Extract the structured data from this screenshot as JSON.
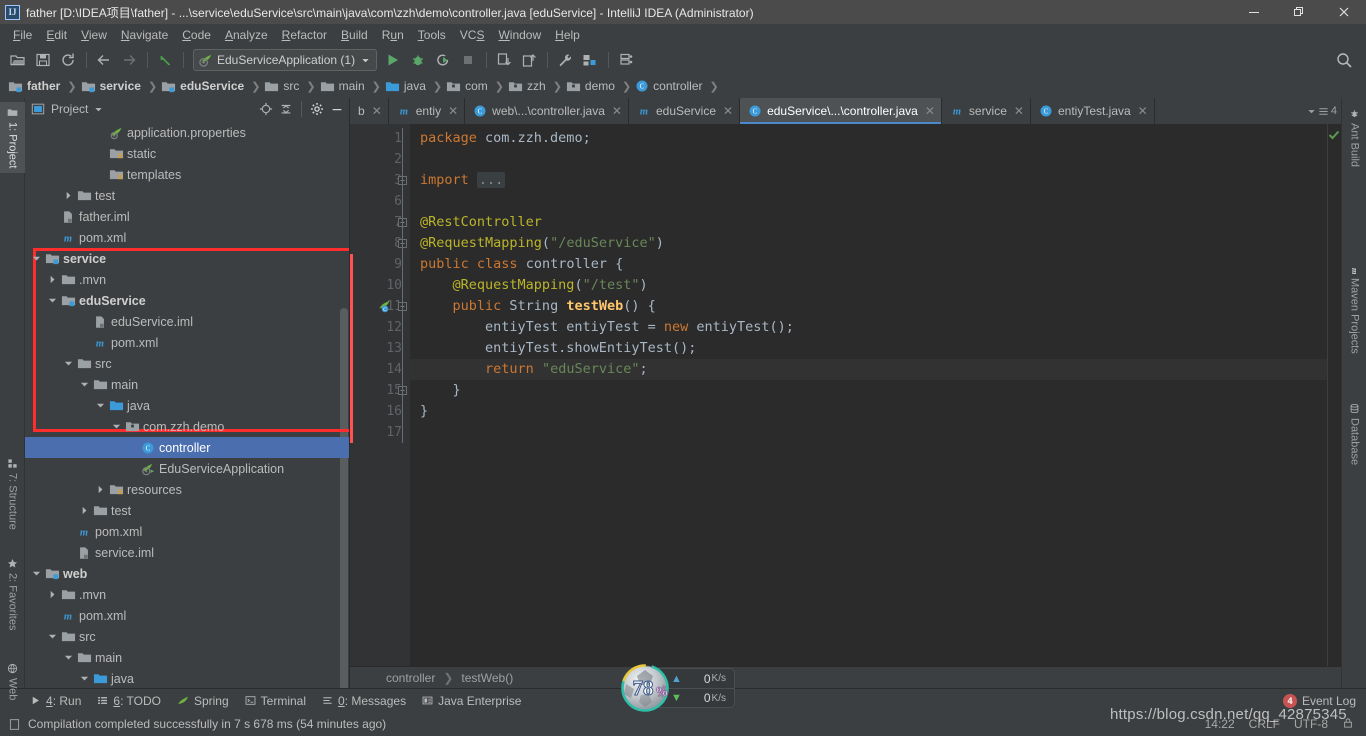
{
  "window": {
    "title": "father [D:\\IDEA项目\\father] - ...\\service\\eduService\\src\\main\\java\\com\\zzh\\demo\\controller.java [eduService] - IntelliJ IDEA (Administrator)",
    "logo": "IJ",
    "minimize": "minimize-icon",
    "maximize": "restore-icon",
    "close": "close-icon"
  },
  "menubar": {
    "items": [
      {
        "label": "File",
        "mnemonic": "F"
      },
      {
        "label": "Edit",
        "mnemonic": "E"
      },
      {
        "label": "View",
        "mnemonic": "V"
      },
      {
        "label": "Navigate",
        "mnemonic": "N"
      },
      {
        "label": "Code",
        "mnemonic": "C"
      },
      {
        "label": "Analyze",
        "mnemonic": "A"
      },
      {
        "label": "Refactor",
        "mnemonic": "R"
      },
      {
        "label": "Build",
        "mnemonic": "B"
      },
      {
        "label": "Run",
        "mnemonic": "u"
      },
      {
        "label": "Tools",
        "mnemonic": "T"
      },
      {
        "label": "VCS",
        "mnemonic": "S"
      },
      {
        "label": "Window",
        "mnemonic": "W"
      },
      {
        "label": "Help",
        "mnemonic": "H"
      }
    ]
  },
  "toolbar": {
    "run_config": "EduServiceApplication (1)",
    "icons": [
      "open-folder-icon",
      "save-all-icon",
      "sync-refresh-icon",
      "back-arrow-icon",
      "forward-arrow-icon",
      "undo-arrow-icon"
    ],
    "run_icons": [
      "run-icon",
      "debug-icon",
      "run-with-coverage-icon",
      "stop-icon"
    ],
    "extra_icons": [
      "update-project-icon",
      "commit-icon",
      "settings-wrench-icon",
      "project-structure-icon",
      "sdk-manager-icon"
    ],
    "search_icon": "search-icon"
  },
  "navbar": {
    "crumbs": [
      {
        "label": "father",
        "icon": "module-icon",
        "bold": true
      },
      {
        "label": "service",
        "icon": "module-icon",
        "bold": true
      },
      {
        "label": "eduService",
        "icon": "module-icon",
        "bold": true
      },
      {
        "label": "src",
        "icon": "folder-icon",
        "bold": false
      },
      {
        "label": "main",
        "icon": "folder-icon",
        "bold": false
      },
      {
        "label": "java",
        "icon": "source-folder-icon",
        "bold": false
      },
      {
        "label": "com",
        "icon": "package-icon",
        "bold": false
      },
      {
        "label": "zzh",
        "icon": "package-icon",
        "bold": false
      },
      {
        "label": "demo",
        "icon": "package-icon",
        "bold": false
      },
      {
        "label": "controller",
        "icon": "class-icon",
        "bold": false
      }
    ]
  },
  "left_rail": {
    "items": [
      {
        "label": "1: Project",
        "icon": "project-icon",
        "active": true
      },
      {
        "label": "7: Structure",
        "icon": "structure-icon",
        "active": false
      },
      {
        "label": "2: Favorites",
        "icon": "star-icon",
        "active": false
      },
      {
        "label": "Web",
        "icon": "web-globe-icon",
        "active": false
      }
    ]
  },
  "right_rail": {
    "items": [
      {
        "label": "Ant Build",
        "icon": "ant-icon"
      },
      {
        "label": "Maven Projects",
        "icon": "maven-m-icon"
      },
      {
        "label": "Database",
        "icon": "database-icon"
      }
    ]
  },
  "project_panel": {
    "title": "Project",
    "header_icons": [
      "target-locate-icon",
      "collapse-all-icon",
      "gear-icon",
      "minimize-icon",
      "close-icon"
    ],
    "tree": [
      {
        "label": "application.properties",
        "icon": "spring-properties-icon",
        "indent": 5,
        "arrow": "none",
        "bold": false
      },
      {
        "label": "static",
        "icon": "resource-folder-icon",
        "indent": 5,
        "arrow": "none",
        "bold": false
      },
      {
        "label": "templates",
        "icon": "resource-folder-icon",
        "indent": 5,
        "arrow": "none",
        "bold": false
      },
      {
        "label": "test",
        "icon": "folder-icon",
        "indent": 3,
        "arrow": "collapsed",
        "bold": false
      },
      {
        "label": "father.iml",
        "icon": "iml-file-icon",
        "indent": 2,
        "arrow": "none",
        "bold": false
      },
      {
        "label": "pom.xml",
        "icon": "maven-m-icon",
        "indent": 2,
        "arrow": "none",
        "bold": false
      },
      {
        "label": "service",
        "icon": "module-icon",
        "indent": 1,
        "arrow": "expanded",
        "bold": true
      },
      {
        "label": ".mvn",
        "icon": "folder-icon",
        "indent": 2,
        "arrow": "collapsed",
        "bold": false
      },
      {
        "label": "eduService",
        "icon": "module-icon",
        "indent": 2,
        "arrow": "expanded",
        "bold": true
      },
      {
        "label": "eduService.iml",
        "icon": "iml-file-icon",
        "indent": 4,
        "arrow": "none",
        "bold": false
      },
      {
        "label": "pom.xml",
        "icon": "maven-m-icon",
        "indent": 4,
        "arrow": "none",
        "bold": false
      },
      {
        "label": "src",
        "icon": "folder-icon",
        "indent": 3,
        "arrow": "expanded",
        "bold": false
      },
      {
        "label": "main",
        "icon": "folder-icon",
        "indent": 4,
        "arrow": "expanded",
        "bold": false
      },
      {
        "label": "java",
        "icon": "source-folder-icon",
        "indent": 5,
        "arrow": "expanded",
        "bold": false
      },
      {
        "label": "com.zzh.demo",
        "icon": "package-icon",
        "indent": 6,
        "arrow": "expanded",
        "bold": false
      },
      {
        "label": "controller",
        "icon": "class-icon",
        "indent": 7,
        "arrow": "none",
        "bold": false,
        "selected": true
      },
      {
        "label": "EduServiceApplication",
        "icon": "spring-boot-class-icon",
        "indent": 7,
        "arrow": "none",
        "bold": false
      },
      {
        "label": "resources",
        "icon": "resource-folder-icon",
        "indent": 5,
        "arrow": "collapsed",
        "bold": false
      },
      {
        "label": "test",
        "icon": "folder-icon",
        "indent": 4,
        "arrow": "collapsed",
        "bold": false
      },
      {
        "label": "pom.xml",
        "icon": "maven-m-icon",
        "indent": 3,
        "arrow": "none",
        "bold": false
      },
      {
        "label": "service.iml",
        "icon": "iml-file-icon",
        "indent": 3,
        "arrow": "none",
        "bold": false
      },
      {
        "label": "web",
        "icon": "module-icon",
        "indent": 1,
        "arrow": "expanded",
        "bold": true
      },
      {
        "label": ".mvn",
        "icon": "folder-icon",
        "indent": 2,
        "arrow": "collapsed",
        "bold": false
      },
      {
        "label": "pom.xml",
        "icon": "maven-m-icon",
        "indent": 2,
        "arrow": "none",
        "bold": false
      },
      {
        "label": "src",
        "icon": "folder-icon",
        "indent": 2,
        "arrow": "expanded",
        "bold": false
      },
      {
        "label": "main",
        "icon": "folder-icon",
        "indent": 3,
        "arrow": "expanded",
        "bold": false
      },
      {
        "label": "java",
        "icon": "source-folder-icon",
        "indent": 4,
        "arrow": "expanded",
        "bold": false
      }
    ]
  },
  "editor": {
    "tabs": [
      {
        "label": "b",
        "icon": "file-icon",
        "active": false,
        "truncated": true
      },
      {
        "label": "entiy",
        "icon": "maven-m-icon",
        "active": false
      },
      {
        "label": "web\\...\\controller.java",
        "icon": "class-icon",
        "active": false
      },
      {
        "label": "eduService",
        "icon": "maven-m-icon",
        "active": false
      },
      {
        "label": "eduService\\...\\controller.java",
        "icon": "class-icon",
        "active": true
      },
      {
        "label": "service",
        "icon": "maven-m-icon",
        "active": false
      },
      {
        "label": "entiyTest.java",
        "icon": "class-icon",
        "active": false
      }
    ],
    "tab_overflow_count": "4",
    "line_numbers": [
      "1",
      "2",
      "3",
      "6",
      "7",
      "8",
      "9",
      "10",
      "11",
      "12",
      "13",
      "14",
      "15",
      "16",
      "17"
    ],
    "breadcrumb": [
      "controller",
      "testWeb()"
    ],
    "inspection_status": "check-ok-icon",
    "code_lines": [
      {
        "n": "1",
        "html": "<span class=\"kw\">package</span> com.zzh.demo;",
        "highlight": false
      },
      {
        "n": "2",
        "html": "",
        "highlight": false
      },
      {
        "n": "3",
        "html": "<span class=\"kw\">import</span> <span class=\"folded\">...</span>",
        "highlight": false
      },
      {
        "n": "6",
        "html": "",
        "highlight": false
      },
      {
        "n": "7",
        "html": "<span class=\"ann\">@RestController</span>",
        "highlight": false
      },
      {
        "n": "8",
        "html": "<span class=\"ann\">@RequestMapping</span>(<span class=\"str\">\"/eduService\"</span>)",
        "highlight": false
      },
      {
        "n": "9",
        "html": "<span class=\"kw\">public class</span> <span class=\"cls\">controller</span> {",
        "highlight": false
      },
      {
        "n": "10",
        "html": "    <span class=\"ann\">@RequestMapping</span>(<span class=\"str\">\"/test\"</span>)",
        "highlight": false
      },
      {
        "n": "11",
        "html": "    <span class=\"kw\">public</span> String <span class=\"meth\">testWeb</span>() {",
        "highlight": false
      },
      {
        "n": "12",
        "html": "        entiyTest entiyTest = <span class=\"kw\">new</span> entiyTest();",
        "highlight": false
      },
      {
        "n": "13",
        "html": "        entiyTest.showEntiyTest();",
        "highlight": false
      },
      {
        "n": "14",
        "html": "        <span class=\"kw\">return</span> <span class=\"str\">\"eduService\"</span>;",
        "highlight": true
      },
      {
        "n": "15",
        "html": "    }",
        "highlight": false
      },
      {
        "n": "16",
        "html": "}",
        "highlight": false
      },
      {
        "n": "17",
        "html": "",
        "highlight": false
      }
    ]
  },
  "bottom_toolwindows": [
    {
      "label": "4: Run",
      "icon": "run-icon",
      "mnemonic": "4"
    },
    {
      "label": "6: TODO",
      "icon": "todo-icon",
      "mnemonic": "6"
    },
    {
      "label": "Spring",
      "icon": "spring-leaf-icon",
      "mnemonic": ""
    },
    {
      "label": "Terminal",
      "icon": "terminal-icon",
      "mnemonic": ""
    },
    {
      "label": "0: Messages",
      "icon": "messages-icon",
      "mnemonic": "0"
    },
    {
      "label": "Java Enterprise",
      "icon": "java-enterprise-icon",
      "mnemonic": ""
    }
  ],
  "event_log": {
    "label": "Event Log",
    "count": "4"
  },
  "statusbar": {
    "icon": "document-icon",
    "message": "Compilation completed successfully in 7 s 678 ms (54 minutes ago)",
    "right_items": [
      "14:22",
      "CRLF",
      "UTF-8",
      "lock-icon"
    ]
  },
  "net_widget": {
    "percent": "78",
    "percent_symbol": "%",
    "upload": "0",
    "download": "0",
    "unit": "K/s",
    "up_arrow": "up-arrow-icon",
    "down_arrow": "down-arrow-icon"
  },
  "watermark": "https://blog.csdn.net/qq_42875345",
  "annotation": {
    "color": "#FF2D2D",
    "shape": "rectangle"
  },
  "colors": {
    "accent": "#4B6EAF",
    "keyword": "#CC7832",
    "annotation": "#BBB529",
    "string": "#6A8759",
    "method": "#FFC66D",
    "identifier": "#A9B7C6",
    "panel_bg": "#3C3F41",
    "editor_bg": "#2B2B2B",
    "gutter_bg": "#313335"
  }
}
